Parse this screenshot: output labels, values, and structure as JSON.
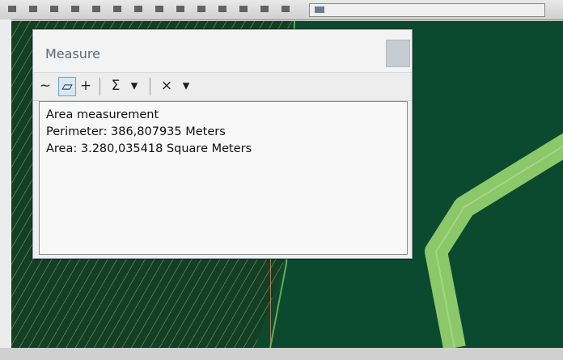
{
  "window": {
    "title": "Measure"
  },
  "toolbar": {
    "tools": [
      {
        "icon": "measure-line-icon",
        "glyph": "~"
      },
      {
        "icon": "measure-area-icon",
        "glyph": "▱",
        "active": true
      },
      {
        "icon": "measure-feature-icon",
        "glyph": "+"
      },
      {
        "icon": "sum-icon",
        "glyph": "Σ"
      },
      {
        "icon": "dropdown-arrow-icon",
        "glyph": "▾"
      },
      {
        "icon": "clear-icon",
        "glyph": "×"
      },
      {
        "icon": "dropdown-arrow-icon",
        "glyph": "▾"
      }
    ]
  },
  "results": {
    "heading": "Area measurement",
    "perimeter": "Perimeter: 386,807935 Meters",
    "area": "Area: 3.280,035418 Square Meters"
  },
  "colors": {
    "map_background": "#0b4a2e",
    "polygon_outline": "#7ac25a",
    "road_fill": "#8cc86a"
  }
}
